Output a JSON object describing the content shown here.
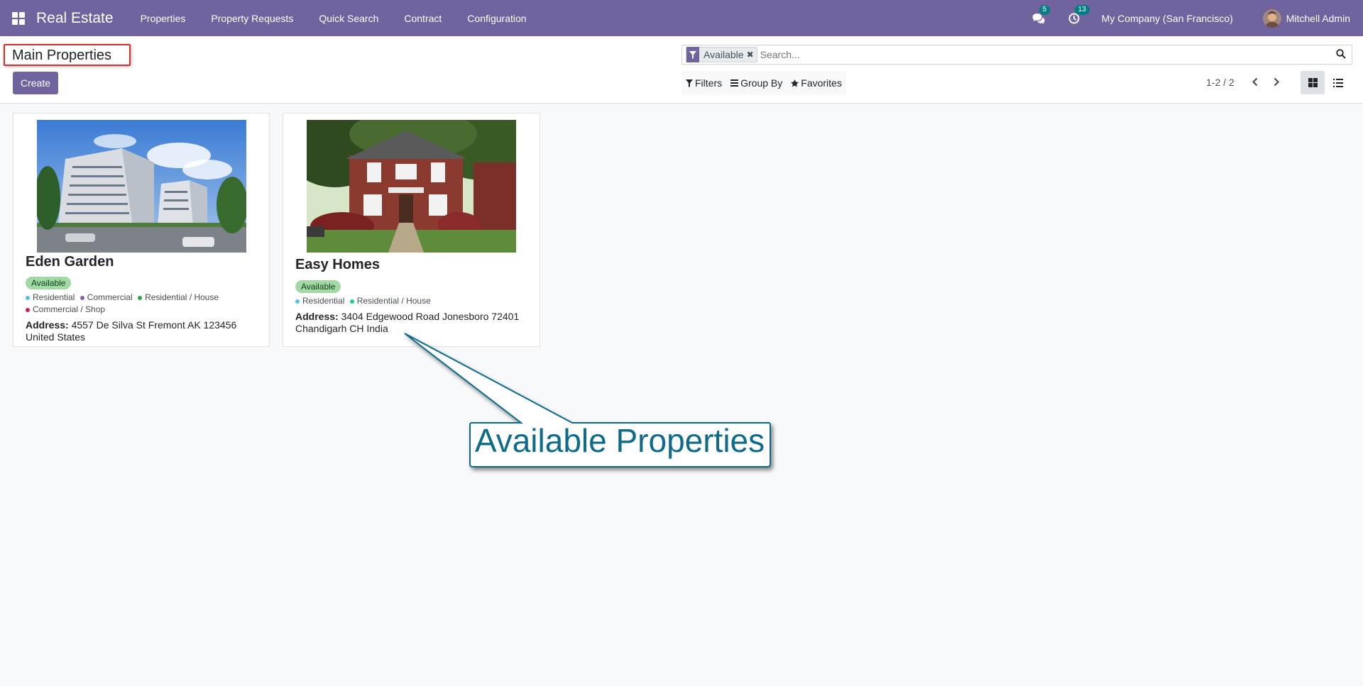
{
  "navbar": {
    "app_name": "Real Estate",
    "menu": [
      "Properties",
      "Property Requests",
      "Quick Search",
      "Contract",
      "Configuration"
    ],
    "messages_count": "5",
    "activities_count": "13",
    "company": "My Company (San Francisco)",
    "user": "Mitchell Admin",
    "icons": [
      "apps-grid-icon",
      "chat-icon",
      "clock-icon",
      "avatar"
    ]
  },
  "control_panel": {
    "breadcrumb": "Main Properties",
    "create_label": "Create",
    "search": {
      "facet": "Available",
      "placeholder": "Search..."
    },
    "filters_label": "Filters",
    "group_by_label": "Group By",
    "favorites_label": "Favorites",
    "pager": "1-2 / 2"
  },
  "cards": [
    {
      "title": "Eden Garden",
      "status": "Available",
      "tags": [
        {
          "label": "Residential",
          "color": "#5bc0de"
        },
        {
          "label": "Commercial",
          "color": "#8e5cb5"
        },
        {
          "label": "Residential / House",
          "color": "#28a745"
        },
        {
          "label": "Commercial / Shop",
          "color": "#dc1f5c"
        }
      ],
      "address_label": "Address:",
      "address": "4557 De Silva St Fremont AK 123456 United States"
    },
    {
      "title": "Easy Homes",
      "status": "Available",
      "tags": [
        {
          "label": "Residential",
          "color": "#5bc0de"
        },
        {
          "label": "Residential / House",
          "color": "#20c997"
        }
      ],
      "address_label": "Address:",
      "address": "3404 Edgewood Road Jonesboro 72401 Chandigarh CH India"
    }
  ],
  "callout": {
    "text": "Available Properties",
    "color": "#0f6b8a"
  },
  "colors": {
    "brand": "#71639e",
    "badge": "#017e84",
    "status_available": "#a3d9a5"
  }
}
